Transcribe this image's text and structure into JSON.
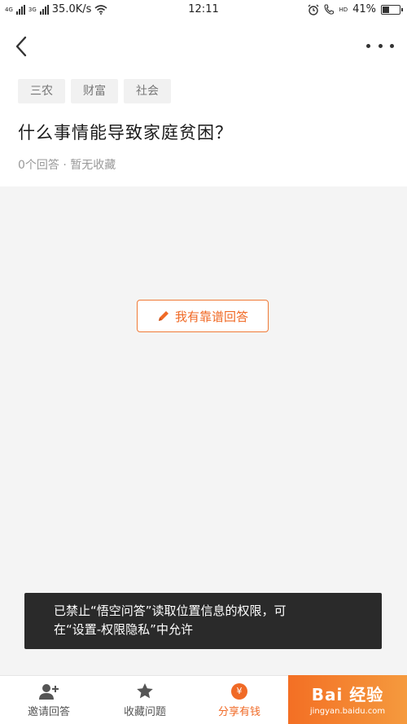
{
  "status_bar": {
    "net_left": "4G",
    "net_right": "3G",
    "speed": "35.0K/s",
    "time": "12:11",
    "hd": "HD",
    "battery": "41%",
    "battery_level": 0.41
  },
  "tags": [
    "三农",
    "财富",
    "社会"
  ],
  "question": {
    "title": "什么事情能导致家庭贫困？",
    "meta": "0个回答 · 暂无收藏"
  },
  "answer_button": {
    "label": "我有靠谱回答"
  },
  "toast": {
    "line1": "已禁止“悟空问答”读取位置信息的权限，可",
    "line2": "在“设置-权限隐私”中允许"
  },
  "bottom_nav": {
    "invite": "邀请回答",
    "collect": "收藏问题",
    "share": "分享有钱",
    "coin_symbol": "¥"
  },
  "watermark": {
    "main": "Bai 经验",
    "sub": "jingyan.baidu.com"
  },
  "colors": {
    "accent": "#f06a26",
    "toast_bg": "#2a2a2a",
    "page_bg": "#f4f4f4"
  }
}
